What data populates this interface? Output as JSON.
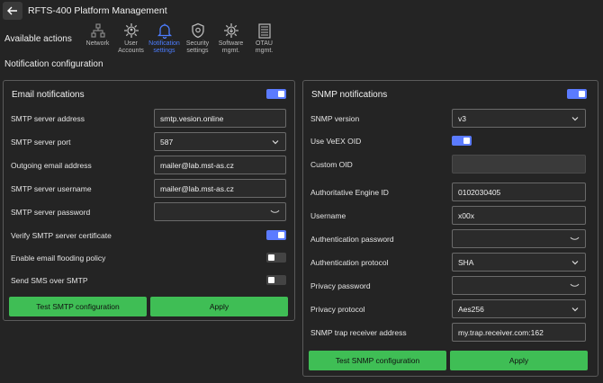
{
  "app": {
    "title": "RFTS-400 Platform Management"
  },
  "actions_label": "Available actions",
  "nav": [
    {
      "label": "Network",
      "icon": "network-icon",
      "active": false
    },
    {
      "label": "User\nAccounts",
      "icon": "user-accounts-icon",
      "active": false
    },
    {
      "label": "Notification\nsettings",
      "icon": "bell-icon",
      "active": true
    },
    {
      "label": "Security\nsettings",
      "icon": "shield-gear-icon",
      "active": false
    },
    {
      "label": "Software\nmgmt.",
      "icon": "software-download-icon",
      "active": false
    },
    {
      "label": "OTAU\nmgmt.",
      "icon": "otau-icon",
      "active": false
    }
  ],
  "section_title": "Notification configuration",
  "email": {
    "title": "Email notifications",
    "enabled": true,
    "fields": {
      "server_address": {
        "label": "SMTP server address",
        "value": "smtp.vesion.online"
      },
      "server_port": {
        "label": "SMTP server port",
        "value": "587"
      },
      "outgoing_address": {
        "label": "Outgoing email address",
        "value": "mailer@lab.mst-as.cz"
      },
      "username": {
        "label": "SMTP server username",
        "value": "mailer@lab.mst-as.cz"
      },
      "password": {
        "label": "SMTP server password",
        "value": ""
      }
    },
    "toggles": {
      "verify_cert": {
        "label": "Verify SMTP server certificate",
        "on": true
      },
      "flooding": {
        "label": "Enable email flooding policy",
        "on": false
      },
      "sms": {
        "label": "Send SMS over SMTP",
        "on": false
      }
    },
    "test_button": "Test SMTP configuration",
    "apply_button": "Apply"
  },
  "snmp": {
    "title": "SNMP notifications",
    "enabled": true,
    "fields": {
      "version": {
        "label": "SNMP version",
        "value": "v3"
      },
      "use_veex_oid": {
        "label": "Use VeEX OID",
        "on": true
      },
      "custom_oid": {
        "label": "Custom OID",
        "value": ""
      },
      "engine_id": {
        "label": "Authoritative Engine ID",
        "value": "0102030405"
      },
      "username": {
        "label": "Username",
        "value": "x00x"
      },
      "auth_password": {
        "label": "Authentication password",
        "value": ""
      },
      "auth_protocol": {
        "label": "Authentication protocol",
        "value": "SHA"
      },
      "privacy_password": {
        "label": "Privacy password",
        "value": ""
      },
      "privacy_protocol": {
        "label": "Privacy protocol",
        "value": "Aes256"
      },
      "trap_address": {
        "label": "SNMP trap receiver address",
        "value": "my.trap.receiver.com:162"
      }
    },
    "test_button": "Test SNMP configuration",
    "apply_button": "Apply"
  },
  "colors": {
    "accent": "#5b7bff",
    "button": "#3fbe55",
    "background": "#242424"
  }
}
